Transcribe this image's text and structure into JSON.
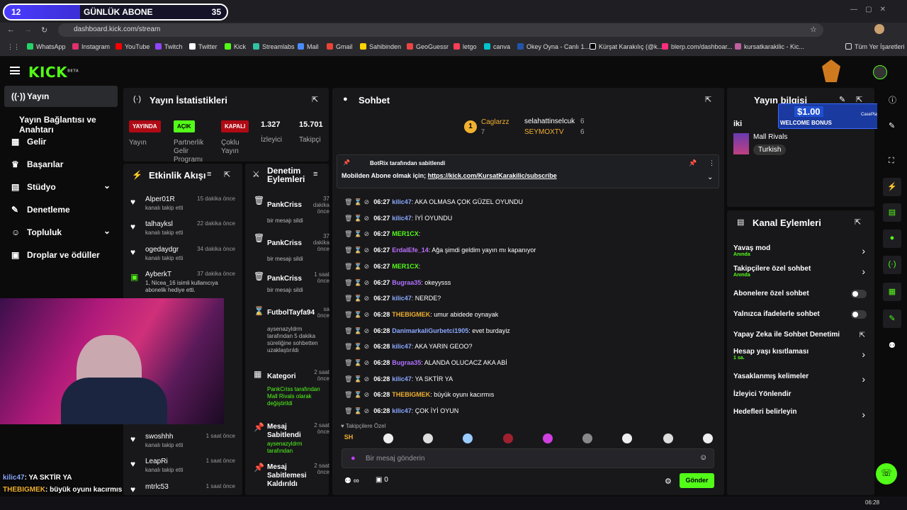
{
  "overlay": {
    "sub_count": "12",
    "sub_label": "GÜNLÜK ABONE",
    "sub_goal": "35",
    "sub_fill": 0.34
  },
  "browser": {
    "url": "dashboard.kick.com/stream",
    "bookmarks": [
      "WhatsApp",
      "Instagram",
      "YouTube",
      "Twitch",
      "Twitter",
      "Kick",
      "Streamlabs",
      "Mail",
      "Gmail",
      "Sahibinden",
      "GeoGuessr",
      "letgo",
      "canva",
      "Okey Oyna - Canlı 1...",
      "Kürşat Karakılıç (@k...",
      "blerp.com/dashboar...",
      "kursatkarakilic - Kic..."
    ],
    "all_bookmarks": "Tüm Yer İşaretleri"
  },
  "brand": {
    "logo": "KICK",
    "beta": "BETA",
    "accent": "#53fc18"
  },
  "sidebar": {
    "items": [
      {
        "label": "Yayın",
        "icon": "broadcast-icon"
      },
      {
        "label": "Yayın Bağlantısı ve Anahtarı"
      },
      {
        "label": "Gelir",
        "icon": "chart-icon"
      },
      {
        "label": "Başarılar",
        "icon": "trophy-icon"
      },
      {
        "label": "Stüdyo",
        "icon": "studio-icon"
      },
      {
        "label": "Denetleme",
        "icon": "wrench-icon"
      },
      {
        "label": "Topluluk",
        "icon": "community-icon"
      },
      {
        "label": "Droplar ve ödüller",
        "icon": "gift-icon"
      }
    ]
  },
  "stats": {
    "title": "Yayın İstatistikleri",
    "live_tag": "YAYINDA",
    "live_label": "Yayın",
    "partner_tag": "AÇIK",
    "partner_label": "Partnerlik Gelir Programı",
    "multi_tag": "KAPALI",
    "multi_label": "Çoklu Yayın",
    "viewers": "1.327",
    "viewers_label": "İzleyici",
    "followers": "15.701",
    "followers_label": "Takipçi"
  },
  "activity": {
    "title": "Etkinlik Akışı",
    "items": [
      {
        "name": "Alper01R",
        "sub": "kanalı takip etti",
        "time": "15 dakika önce"
      },
      {
        "name": "talhayksl",
        "sub": "kanalı takip etti",
        "time": "22 dakika önce"
      },
      {
        "name": "ogedaydgr",
        "sub": "kanalı takip etti",
        "time": "34 dakika önce"
      },
      {
        "name": "AyberkT",
        "sub": "1, Nicea_16 isimli kullanıcıya abonelik hediye etti.",
        "time": "37 dakika önce"
      },
      {
        "name": "swoshhh",
        "sub": "kanalı takip etti",
        "time": "1 saat önce"
      },
      {
        "name": "LeapRi",
        "sub": "kanalı takip etti",
        "time": "1 saat önce"
      },
      {
        "name": "mtrlc53",
        "sub": "",
        "time": "1 saat önce"
      }
    ]
  },
  "moderation": {
    "title": "Denetim Eylemleri",
    "items": [
      {
        "name": "PankCriss",
        "sub": "bir mesajı sildi",
        "time": "37 dakika önce"
      },
      {
        "name": "PankCriss",
        "sub": "bir mesajı sildi",
        "time": "37 dakika önce"
      },
      {
        "name": "PankCriss",
        "sub": "bir mesajı sildi",
        "time": "1 saat önce"
      },
      {
        "name": "FutbolTayfa94",
        "sub": "aysenazyldrm tarafından 5 dakika süreliğine sohbetten uzaklaştırıldı",
        "time": "sa önce"
      },
      {
        "name": "Kategori",
        "sub": "PankCriss tarafından Mall Rivals olarak değiştirildi",
        "time": "2 saat önce"
      },
      {
        "name": "Mesaj Sabitlendi",
        "sub": "aysenazyldrm tarafından",
        "time": "2 saat önce"
      },
      {
        "name": "Mesaj Sabitlemesi Kaldırıldı",
        "sub": "",
        "time": "2 saat önce"
      }
    ]
  },
  "chat": {
    "title": "Sohbet",
    "top": [
      {
        "name": "Caglarzz",
        "count": "7",
        "rank": "1"
      },
      {
        "name": "selahattinselcuk",
        "count": "6"
      },
      {
        "name": "SEYMOXTV",
        "count": "6"
      }
    ],
    "pinned_by": "BotRix tarafından sabitlendi",
    "pinned_text": "Mobilden Abone olmak için; ",
    "pinned_link": "https://kick.com/KursatKarakilic/subscribe",
    "messages": [
      {
        "time": "06:27",
        "user": "kilic47",
        "color": "#8aa8ff",
        "text": ": AKA OLMASA ÇOK GÜZEL OYUNDU"
      },
      {
        "time": "06:27",
        "user": "kilic47",
        "color": "#8aa8ff",
        "text": ": İYİ OYUNDU"
      },
      {
        "time": "06:27",
        "user": "MER1CX",
        "color": "#53fc18",
        "text": ":"
      },
      {
        "time": "06:27",
        "user": "ErdalEfe_14",
        "color": "#c070ff",
        "text": ": Ağa şimdi geldim yayın mı kapanıyor"
      },
      {
        "time": "06:27",
        "user": "MER1CX",
        "color": "#53fc18",
        "text": ":"
      },
      {
        "time": "06:27",
        "user": "Bugraa35",
        "color": "#b070ff",
        "text": ": okeyysss"
      },
      {
        "time": "06:27",
        "user": "kilic47",
        "color": "#8aa8ff",
        "text": ": NERDE?"
      },
      {
        "time": "06:28",
        "user": "THEBIGMEK",
        "color": "#f0b030",
        "text": ": umur abidede oynayak"
      },
      {
        "time": "06:28",
        "user": "DanimarkaliGurbetci1905",
        "color": "#8aa8ff",
        "text": ": evet burdayiz"
      },
      {
        "time": "06:28",
        "user": "kilic47",
        "color": "#8aa8ff",
        "text": ": AKA YARIN GEOO?"
      },
      {
        "time": "06:28",
        "user": "Bugraa35",
        "color": "#b070ff",
        "text": ": ALANDA OLUCACZ AKA ABİ"
      },
      {
        "time": "06:28",
        "user": "kilic47",
        "color": "#8aa8ff",
        "text": ": YA SKTİR YA"
      },
      {
        "time": "06:28",
        "user": "THEBIGMEK",
        "color": "#f0b030",
        "text": ": büyük oyunı kacırmıs"
      },
      {
        "time": "06:28",
        "user": "kilic47",
        "color": "#8aa8ff",
        "text": ": ÇOK İYİ OYUN"
      }
    ],
    "followers_only": "Takipçilere Özel",
    "placeholder": "Bir mesaj gönderin",
    "send": "Gönder",
    "viewer_count": "0"
  },
  "stream_info": {
    "title": "Yayın bilgisi",
    "lang_prefix": "iki",
    "category": "Mall Rivals",
    "language": "Turkish"
  },
  "promo": {
    "amount": "$1.00",
    "label": "WELCOME BONUS",
    "brand": "CasePlay"
  },
  "channel_actions": {
    "title": "Kanal Eylemleri",
    "items": [
      {
        "label": "Yavaş mod",
        "sub": "Anında",
        "type": "chev"
      },
      {
        "label": "Takipçilere özel sohbet",
        "sub": "Anında",
        "type": "chev"
      },
      {
        "label": "Abonelere özel sohbet",
        "sub": "",
        "type": "toggle"
      },
      {
        "label": "Yalnızca ifadelerle sohbet",
        "sub": "",
        "type": "toggle"
      },
      {
        "label": "Yapay Zeka ile Sohbet Denetimi",
        "sub": "",
        "type": "ext"
      },
      {
        "label": "Hesap yaşı kısıtlaması",
        "sub": "1 sa.",
        "type": "chev"
      },
      {
        "label": "Yasaklanmış kelimeler",
        "sub": "",
        "type": "chev"
      },
      {
        "label": "İzleyici Yönlendir",
        "sub": "",
        "type": "none"
      },
      {
        "label": "Hedefleri belirleyin",
        "sub": "",
        "type": "chev"
      }
    ]
  },
  "overlay_chat": [
    {
      "user": "kilic47",
      "text": ": YA SKTİR YA"
    },
    {
      "user": "THEBIGMEK",
      "text": ": büyük oyunı kacırmıs"
    },
    {
      "user": "kilic47",
      "text": ": ÇOK İYİ OYUN"
    }
  ],
  "clock": "06:28"
}
